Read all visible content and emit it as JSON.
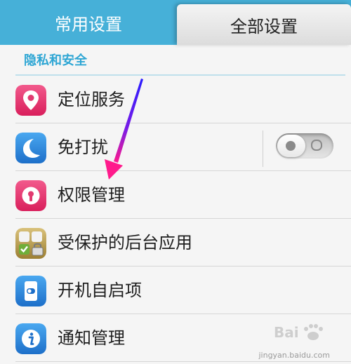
{
  "tabs": {
    "common": "常用设置",
    "all": "全部设置",
    "active": "all"
  },
  "section": {
    "title": "隐私和安全"
  },
  "items": [
    {
      "label": "定位服务",
      "icon": "location-pin-icon",
      "color": "#e8336f"
    },
    {
      "label": "免打扰",
      "icon": "moon-icon",
      "color": "#2a8ee0",
      "toggle": {
        "on": false
      }
    },
    {
      "label": "权限管理",
      "icon": "keyhole-icon",
      "color": "#e8336f"
    },
    {
      "label": "受保护的后台应用",
      "icon": "app-lock-icon",
      "color": "#b59a4a"
    },
    {
      "label": "开机自启项",
      "icon": "phone-switch-icon",
      "color": "#2a8ee0"
    },
    {
      "label": "通知管理",
      "icon": "info-icon",
      "color": "#2a8ee0"
    }
  ],
  "watermark": {
    "text": "jingyan.baidu.com"
  },
  "colors": {
    "tab_bar": "#46b0d8",
    "section_title": "#2ea6d4",
    "annotation_arrow": "#3b1cff"
  }
}
